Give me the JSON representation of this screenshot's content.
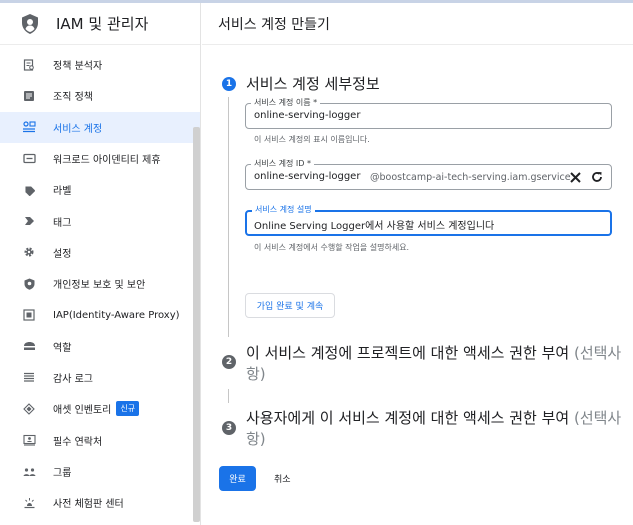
{
  "colors": {
    "accent": "#1a73e8",
    "active_bg": "#e8f0fe",
    "step_gray": "#5f6368"
  },
  "sidebar": {
    "title": "IAM 및 관리자",
    "logo_icon": "iam-shield-icon",
    "items": [
      {
        "label": "정책 분석자",
        "icon": "policy-analyzer-icon"
      },
      {
        "label": "조직 정책",
        "icon": "org-policy-icon"
      },
      {
        "label": "서비스 계정",
        "icon": "service-account-icon",
        "active": true
      },
      {
        "label": "워크로드 아이덴티티 제휴",
        "icon": "workload-identity-icon"
      },
      {
        "label": "라벨",
        "icon": "label-icon"
      },
      {
        "label": "태그",
        "icon": "tag-icon"
      },
      {
        "label": "설정",
        "icon": "gear-icon"
      },
      {
        "label": "개인정보 보호 및 보안",
        "icon": "privacy-shield-icon"
      },
      {
        "label": "IAP(Identity-Aware Proxy)",
        "icon": "iap-icon"
      },
      {
        "label": "역할",
        "icon": "roles-icon"
      },
      {
        "label": "감사 로그",
        "icon": "audit-log-icon"
      },
      {
        "label": "애셋 인벤토리",
        "icon": "asset-inventory-icon",
        "badge": "신규"
      },
      {
        "label": "필수 연락처",
        "icon": "contacts-icon"
      },
      {
        "label": "그룹",
        "icon": "groups-icon"
      },
      {
        "label": "사전 체험판 센터",
        "icon": "preview-center-icon"
      }
    ]
  },
  "page": {
    "title": "서비스 계정 만들기"
  },
  "step1": {
    "number": "1",
    "title": "서비스 계정 세부정보",
    "name_field": {
      "label": "서비스 계정 이름 *",
      "value": "online-serving-logger",
      "hint": "이 서비스 계정의 표시 이름입니다."
    },
    "id_field": {
      "label": "서비스 계정 ID *",
      "value": "online-serving-logger",
      "suffix": "@boostcamp-ai-tech-serving.iam.gservice"
    },
    "desc_field": {
      "label": "서비스 계정 설명",
      "value": "Online Serving Logger에서 사용할 서비스 계정입니다",
      "hint": "이 서비스 계정에서 수행할 작업을 설명하세요."
    },
    "continue_label": "가입 완료 및 계속"
  },
  "step2": {
    "number": "2",
    "title": "이 서비스 계정에 프로젝트에 대한 액세스 권한 부여",
    "optional_open": "(선택사",
    "optional_close": "항)"
  },
  "step3": {
    "number": "3",
    "title": "사용자에게 이 서비스 계정에 대한 액세스 권한 부여",
    "optional_open": "(선택사",
    "optional_close": "항)"
  },
  "actions": {
    "done_label": "완료",
    "cancel_label": "취소"
  }
}
